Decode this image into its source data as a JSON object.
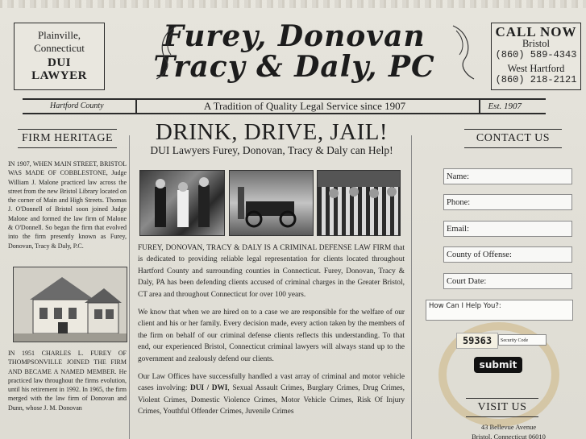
{
  "header": {
    "left_box": {
      "line1": "Plainville,",
      "line2": "Connecticut",
      "line3": "DUI",
      "line4": "LAWYER"
    },
    "title_line1": "Furey, Donovan",
    "title_line2": "Tracy & Daly, PC",
    "right_box": {
      "callnow": "CALL NOW",
      "city1": "Bristol",
      "phone1": "(860) 589-4343",
      "city2": "West Hartford",
      "phone2": "(860) 218-2121"
    }
  },
  "tagline": {
    "county": "Hartford County",
    "tradition": "A Tradition of Quality Legal Service since 1907",
    "est": "Est. 1907"
  },
  "left_column": {
    "heading": "FIRM HERITAGE",
    "para1": "IN 1907, WHEN MAIN STREET, BRISTOL WAS MADE OF COBBLESTONE, Judge William J. Malone practiced law across the street from the new Bristol Library located on the corner of Main and High Streets. Thomas J. O'Donnell of Bristol soon joined Judge Malone and formed the law firm of Malone & O'Donnell. So began the firm that evolved into the firm presently known as Furey, Donovan, Tracy & Daly, P.C.",
    "para2": "IN 1951 CHARLES L. FUREY OF THOMPSONVILLE JOINED THE FIRM AND BECAME A NAMED MEMBER. He practiced law throughout the firms evolution, until his retirement in 1992. In 1965, the firm merged with the law firm of Donovan and Dunn, whose J. M. Donovan"
  },
  "main": {
    "headline": "DRINK, DRIVE, JAIL!",
    "subhead": "DUI Lawyers Furey, Donovan, Tracy & Daly can Help!",
    "p1": "FUREY, DONOVAN, TRACY & DALY IS A CRIMINAL DEFENSE LAW FIRM that is dedicated to providing reliable legal representation for clients located throughout Hartford County and surrounding counties in Connecticut. Furey, Donovan, Tracy & Daly, PA has been defending clients accused of criminal charges in the Greater Bristol, CT area and throughout Connecticut for over 100 years.",
    "p2": "We know that when we are hired on to a case we are responsible for the welfare of our client and his or her family. Every decision made, every action taken by the members of the firm on behalf of our criminal defense clients reflects this understanding. To that end, our experienced Bristol, Connecticut criminal lawyers will always stand up to the government and zealously defend our clients.",
    "p3_start": "Our Law Offices have successfully handled a vast array of criminal and motor vehicle cases involving: ",
    "p3_bold": "DUI / DWI",
    "p3_end": ", Sexual Assault Crimes, Burglary Crimes, Drug Crimes, Violent Crimes, Domestic Violence Crimes, Motor Vehicle Crimes, Risk Of Injury Crimes, Youthful Offender Crimes, Juvenile Crimes"
  },
  "right_column": {
    "heading": "CONTACT US",
    "fields": [
      "Name:",
      "Phone:",
      "Email:",
      "County of Offense:",
      "Court Date:"
    ],
    "help_placeholder": "How Can I Help You?:",
    "captcha": "59363",
    "security_placeholder": "Security Code",
    "submit": "submit",
    "visit_heading": "VISIT US",
    "address1": "43 Bellevue Avenue",
    "address2": "Bristol, Connecticut 06010"
  }
}
